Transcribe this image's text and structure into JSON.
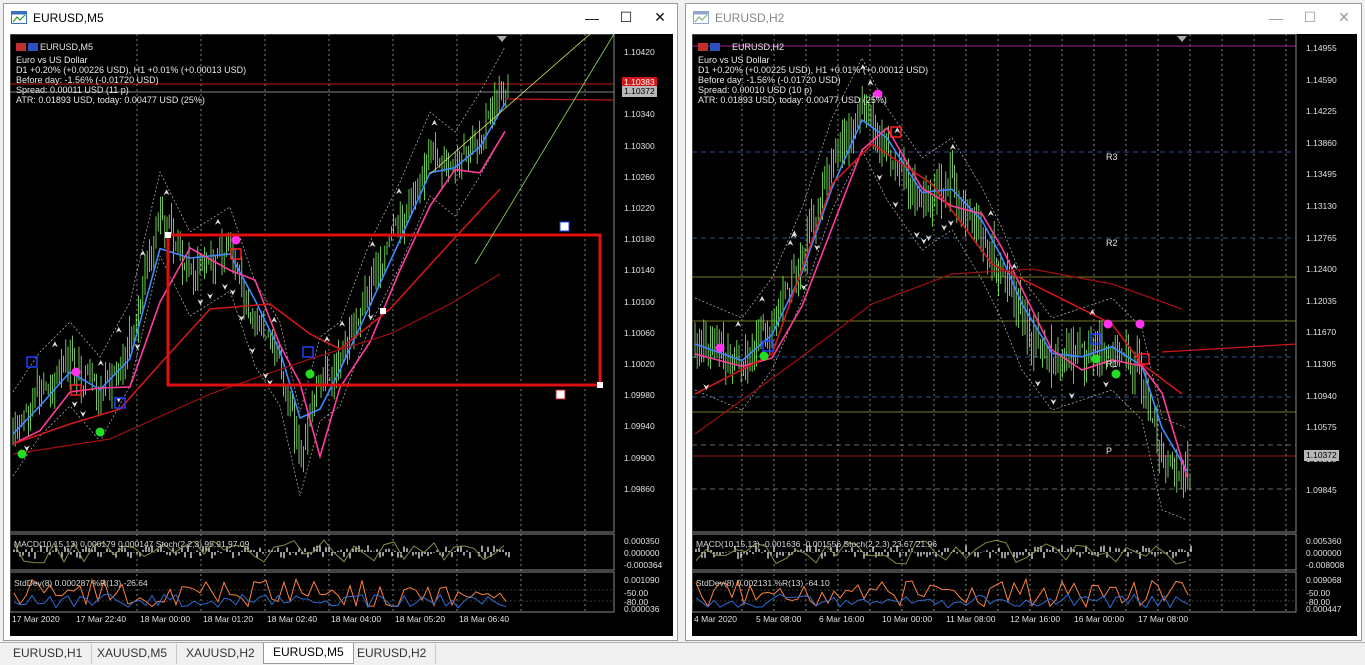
{
  "windows": [
    {
      "title": "EURUSD,M5",
      "symbol_label": "EURUSD,M5",
      "info_lines": [
        "Euro vs US Dollar",
        "D1 +0.20% (+0.00226 USD), H1 +0.01% (+0.00013 USD)",
        "Before day: -1.56% (-0.01720 USD)",
        "Spread: 0.00011 USD (11 p)",
        "ATR: 0.01893 USD, today: 0.00477 USD (25%)"
      ],
      "price_axis": [
        "1.10420",
        "1.10380",
        "1.10340",
        "1.10300",
        "1.10260",
        "1.10220",
        "1.10180",
        "1.10140",
        "1.10100",
        "1.10060",
        "1.10020",
        "1.09980",
        "1.09940",
        "1.09900",
        "1.09860"
      ],
      "bid_price": "1.10372",
      "ask_price": "1.10383",
      "macd_label": "MACD(10,15,13) 0.000179 0.000147 Stoch(2,2,3) 95.91 97.09",
      "stddev_label": "StdDev(8) 0.000287 %R(13) -26.64",
      "macd_axis": [
        "0.000350",
        "0.000000",
        "-0.000364"
      ],
      "stddev_axis": [
        "0.001090",
        "-50.00",
        "-80.00",
        "0.000036"
      ],
      "time_axis": [
        "17 Mar 2020",
        "17 Mar 22:40",
        "18 Mar 00:00",
        "18 Mar 01:20",
        "18 Mar 02:40",
        "18 Mar 04:00",
        "18 Mar 05:20",
        "18 Mar 06:40"
      ]
    },
    {
      "title": "EURUSD,H2",
      "symbol_label": "EURUSD,H2",
      "info_lines": [
        "Euro vs US Dollar",
        "D1 +0.20% (+0.00225 USD), H1 +0.01% (+0.00012 USD)",
        "Before day: -1.56% (-0.01720 USD)",
        "Spread: 0.00010 USD (10 p)",
        "ATR: 0.01893 USD, today: 0.00477 USD (25%)"
      ],
      "price_axis": [
        "1.14955",
        "1.14590",
        "1.14225",
        "1.13860",
        "1.13495",
        "1.13130",
        "1.12765",
        "1.12400",
        "1.12035",
        "1.11670",
        "1.11305",
        "1.10940",
        "1.10575",
        "1.10210",
        "1.09845"
      ],
      "bid_price": "1.10372",
      "pivot_labels": [
        "R3",
        "R2",
        "R1",
        "P"
      ],
      "macd_label": "MACD(10,15,13) -0.001636 -0.001556 Stoch(2,2,3) 23.67 21.96",
      "stddev_label": "StdDev(8) 0.002131 %R(13) -64.10",
      "macd_axis": [
        "0.005360",
        "0.000000",
        "-0.008008"
      ],
      "stddev_axis": [
        "0.009068",
        "-50.00",
        "-80.00",
        "0.000447"
      ],
      "time_axis": [
        "4 Mar 2020",
        "5 Mar 08:00",
        "6 Mar 16:00",
        "10 Mar 00:00",
        "11 Mar 08:00",
        "12 Mar 16:00",
        "16 Mar 00:00",
        "17 Mar 08:00"
      ]
    }
  ],
  "tabs": [
    "EURUSD,H1",
    "XAUUSD,M5",
    "XAUUSD,H2",
    "EURUSD,M5",
    "EURUSD,H2"
  ],
  "active_tab": "EURUSD,M5",
  "colors": {
    "bull_candle": "#7cfc5a",
    "bear_candle": "#ffffff",
    "ma_blue": "#3c8cff",
    "ma_pink": "#ff3c9c",
    "ma_red": "#d01818",
    "macd_hist": "#ffffff",
    "stddev": "#2e6ad8",
    "williams": "#ff8040",
    "ask_line": "#ff2020",
    "bid_line": "#b0b0b0"
  },
  "icons": [
    "chart-window-icon",
    "minimize-icon",
    "maximize-icon",
    "close-icon"
  ]
}
